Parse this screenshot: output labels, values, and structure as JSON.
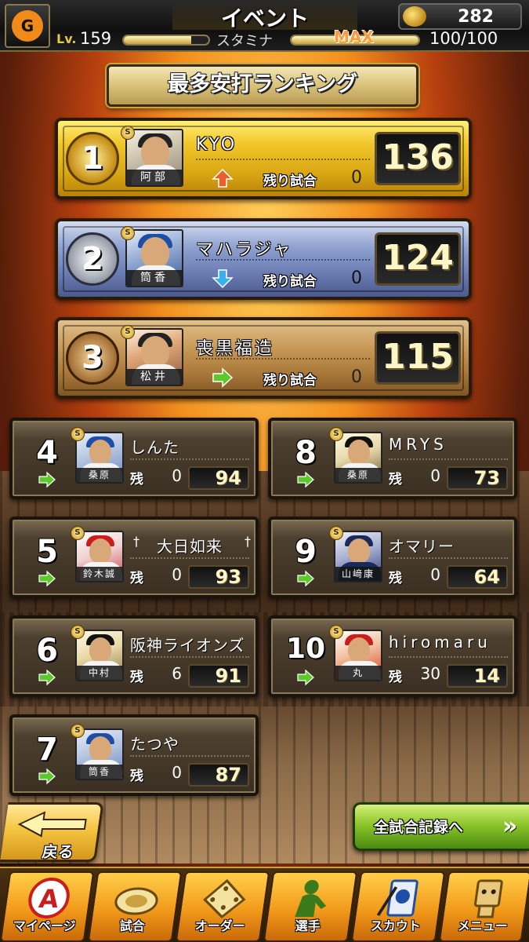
{
  "header": {
    "title": "イベント",
    "team_logo_icon": "giants-logo-icon",
    "currency_icon": "bat-coin-icon",
    "currency_count": "282",
    "level_label": "Lv.",
    "level_value": "159",
    "level_progress": 0.8,
    "stamina_label": "スタミナ",
    "stamina_max_label": "MAX",
    "stamina_progress": 1.0,
    "stamina_value": "100/100"
  },
  "banner": {
    "title": "最多安打ランキング"
  },
  "remain_label": "残り試合",
  "remain_short_label": "残",
  "top3": [
    {
      "rank": "1",
      "player": "阿部",
      "name": "KYO",
      "trend": "up",
      "remaining": "0",
      "score": "136",
      "medal": "gold"
    },
    {
      "rank": "2",
      "player": "筒香",
      "name": "マハラジャ",
      "trend": "down",
      "remaining": "0",
      "score": "124",
      "medal": "silver"
    },
    {
      "rank": "3",
      "player": "松井",
      "name": "喪黒福造",
      "trend": "same",
      "remaining": "0",
      "score": "115",
      "medal": "bronze"
    }
  ],
  "ranks": [
    {
      "rank": "4",
      "player": "桑原",
      "name": "しんた",
      "trend": "same",
      "remaining": "0",
      "score": "94"
    },
    {
      "rank": "5",
      "player": "鈴木誠",
      "name": "大日如来",
      "trend": "same",
      "remaining": "0",
      "score": "93",
      "name_prefix": "†",
      "name_suffix": "†"
    },
    {
      "rank": "6",
      "player": "中村",
      "name": "阪神ライオンズ",
      "trend": "same",
      "remaining": "6",
      "score": "91"
    },
    {
      "rank": "7",
      "player": "筒香",
      "name": "たつや",
      "trend": "same",
      "remaining": "0",
      "score": "87"
    },
    {
      "rank": "8",
      "player": "桑原",
      "name": "MRYS",
      "trend": "same",
      "remaining": "0",
      "score": "73"
    },
    {
      "rank": "9",
      "player": "山﨑康",
      "name": "オマリー",
      "trend": "same",
      "remaining": "0",
      "score": "64"
    },
    {
      "rank": "10",
      "player": "丸",
      "name": "hiromaru",
      "trend": "same",
      "remaining": "30",
      "score": "14"
    }
  ],
  "buttons": {
    "back_label": "戻る",
    "record_label": "全試合記録へ",
    "record_icon": "double-chevron-right-icon"
  },
  "nav": [
    {
      "label": "マイページ",
      "icon": "mypage-a-icon"
    },
    {
      "label": "試合",
      "icon": "stadium-icon"
    },
    {
      "label": "オーダー",
      "icon": "field-order-icon"
    },
    {
      "label": "選手",
      "icon": "player-icon"
    },
    {
      "label": "スカウト",
      "icon": "scout-card-icon"
    },
    {
      "label": "メニュー",
      "icon": "menu-character-icon"
    }
  ],
  "colors": {
    "trend_up": "#e8602a",
    "trend_down": "#3ab0e8",
    "trend_same": "#5cc82a"
  }
}
